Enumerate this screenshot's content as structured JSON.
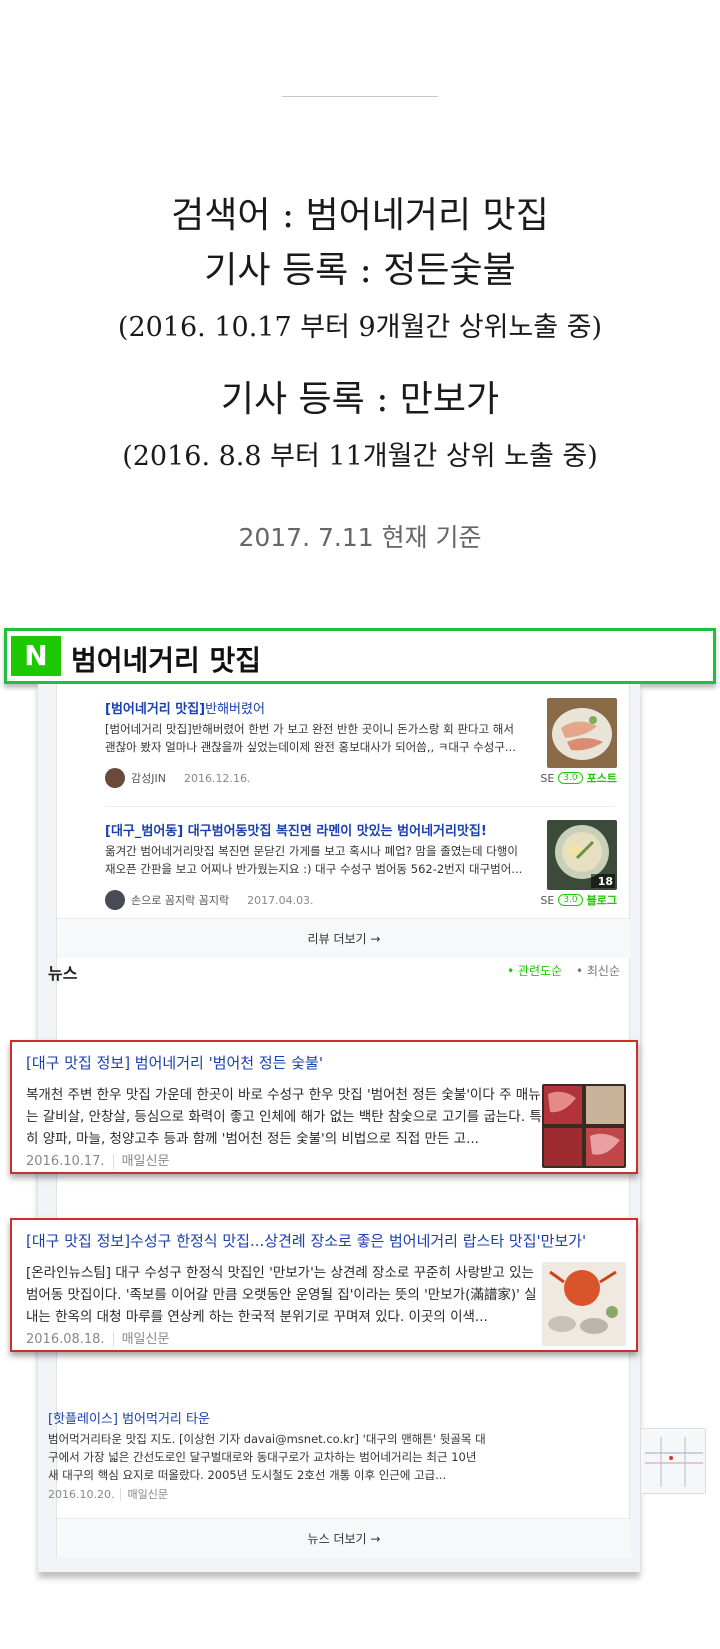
{
  "intro": {
    "line1": "검색어 : 범어네거리 맛집",
    "line2": "기사 등록 : 정든숯불",
    "line3": "(2016. 10.17 부터 9개월간 상위노출 중)",
    "line4": "기사 등록 : 만보가",
    "line5": "(2016. 8.8 부터 11개월간 상위 노출 중)",
    "as_of": "2017. 7.11 현재 기준"
  },
  "search": {
    "logo": "N",
    "query": "범어네거리 맛집"
  },
  "reviews": {
    "items": [
      {
        "title_bold": "[범어네거리 맛집]",
        "title_rest": "반해버렸어",
        "desc": "[범어네거리 맛집]반해버렸어 한번 가 보고 완전 반한 곳이니 돈가스랑 회 판다고 해서 괜찮아 봤자 얼마나 괜찮을까 싶었는데이제 완전 홍보대사가 되어씀,, ㅋ대구 수성구...",
        "author": "감성JIN",
        "date": "2016.12.16.",
        "se": "SE",
        "se_ver": "3.0",
        "type": "포스트"
      },
      {
        "title_bold": "[대구_범어동] 대구범어동맛집 복진면 라멘이 맛있는 범어네거리맛집!",
        "title_rest": "",
        "desc": "옮겨간 범어네거리맛집 복진면 문닫긴 가게를 보고 혹시나 폐업? 맘을 졸였는데 다행이 재오픈 간판을 보고 어찌나 반가웠는지요 :) 대구 수성구 범어동 562-2번지 대구범어...",
        "author": "손으로 꼼지락 꼼지락",
        "date": "2017.04.03.",
        "se": "SE",
        "se_ver": "3.0",
        "type": "블로그",
        "photo_count": "18"
      }
    ],
    "more": "리뷰 더보기 →"
  },
  "news": {
    "heading": "뉴스",
    "sort_active": "관련도순",
    "sort_other": "최신순",
    "items": [
      {
        "title": "[대구 맛집 정보] 범어네거리 '범어천 정든 숯불'",
        "desc": "복개천 주변 한우 맛집 가운데 한곳이 바로 수성구 한우 맛집 '범어천 정든 숯불'이다 주 매뉴는 갈비살, 안창살, 등심으로 화력이 좋고 인체에 해가 없는 백탄 참숯으로 고기를 굽는다. 특히 양파, 마늘, 청양고추 등과 함께 '범어천 정든 숯불'의 비법으로 직접 만든 고...",
        "date": "2016.10.17.",
        "source": "매일신문"
      },
      {
        "title": "[대구 맛집 정보]수성구 한정식 맛집...상견례 장소로 좋은 범어네거리 랍스타 맛집'만보가'",
        "desc": "[온라인뉴스팀] 대구 수성구 한정식 맛집인 '만보가'는 상견례 장소로 꾸준히 사랑받고 있는 범어동 맛집이다. '족보를 이어갈 만큼 오랫동안 운영될 집'이라는 뜻의 '만보가(滿譜家)' 실내는 한옥의 대청 마루를 연상케 하는 한국적 분위기로 꾸며져 있다. 이곳의 이색...",
        "date": "2016.08.18.",
        "source": "매일신문"
      },
      {
        "title": "[핫플레이스] 범어먹거리 타운",
        "desc": "범어먹거리타운 맛집 지도. [이상헌 기자 davai@msnet.co.kr] '대구의 맨해튼' 뒷골목 대구에서 가장 넓은 간선도로인 달구벌대로와 동대구로가 교차하는 범어네거리는 최근 10년 새 대구의 핵심 요지로 떠올랐다. 2005년 도시철도 2호선 개통 이후 인근에 고급...",
        "date": "2016.10.20.",
        "source": "매일신문"
      }
    ],
    "more": "뉴스 더보기 →"
  },
  "colors": {
    "naver_green": "#1ec800",
    "link_blue": "#1a3fb0",
    "highlight_red": "#c9302c"
  }
}
